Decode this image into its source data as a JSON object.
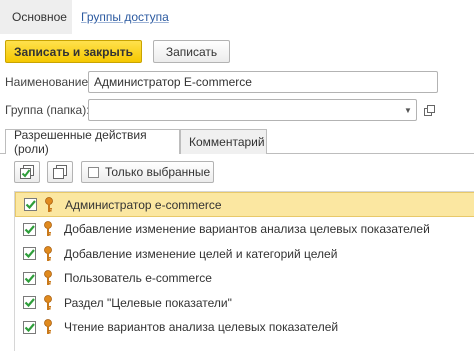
{
  "tabs": {
    "main": "Основное",
    "access_groups": "Группы доступа"
  },
  "commands": {
    "save_close": "Записать и закрыть",
    "save": "Записать"
  },
  "form": {
    "name_label": "Наименование:",
    "name_value": "Администратор E-commerce",
    "group_label": "Группа (папка):",
    "group_value": ""
  },
  "inner_tabs": {
    "roles": "Разрешенные действия (роли)",
    "comment": "Комментарий"
  },
  "toolbar": {
    "only_selected": "Только выбранные"
  },
  "roles": [
    {
      "label": "Администратор e-commerce",
      "checked": true,
      "selected": true
    },
    {
      "label": "Добавление изменение вариантов анализа целевых показателей",
      "checked": true,
      "selected": false
    },
    {
      "label": "Добавление изменение целей и категорий целей",
      "checked": true,
      "selected": false
    },
    {
      "label": "Пользователь e-commerce",
      "checked": true,
      "selected": false
    },
    {
      "label": "Раздел \"Целевые показатели\"",
      "checked": true,
      "selected": false
    },
    {
      "label": "Чтение вариантов анализа целевых показателей",
      "checked": true,
      "selected": false
    }
  ],
  "icons": {
    "check": "checkmark-icon",
    "role": "key-icon",
    "check_all": "check-all-icon",
    "uncheck_all": "uncheck-all-icon",
    "dropdown": "triangle-down-icon",
    "open": "open-form-icon"
  },
  "colors": {
    "primary_button": "#f5c800",
    "selected_row": "#fbe7a1",
    "link": "#2c5aa0",
    "check_green": "#2e9e3a",
    "key_orange": "#e08a1e"
  }
}
